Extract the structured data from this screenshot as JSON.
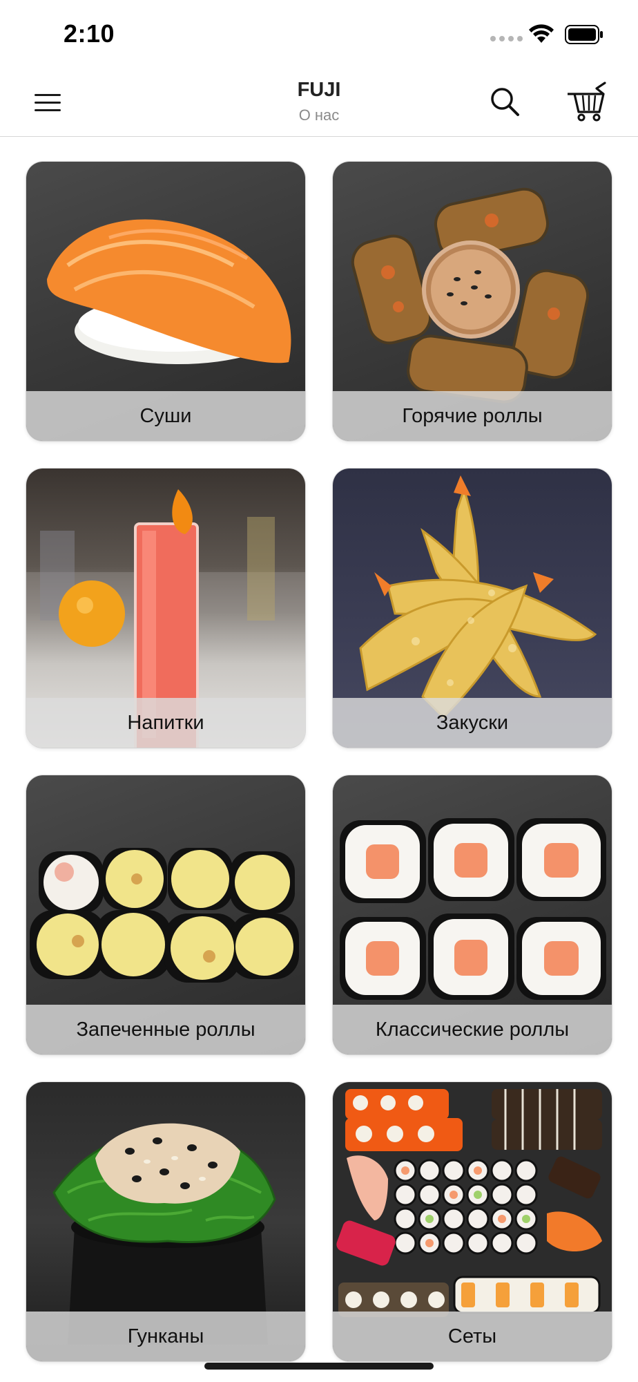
{
  "status_bar": {
    "time": "2:10"
  },
  "header": {
    "title": "FUJI",
    "subtitle": "О нас",
    "menu_icon": "hamburger-menu-icon",
    "search_icon": "search-icon",
    "cart_icon": "cart-icon"
  },
  "categories": [
    {
      "label": "Суши",
      "image": "salmon-nigiri"
    },
    {
      "label": "Горячие роллы",
      "image": "tempura-rolls-with-sauce"
    },
    {
      "label": "Напитки",
      "image": "red-cocktail-with-orange"
    },
    {
      "label": "Закуски",
      "image": "tempura-shrimp"
    },
    {
      "label": "Запеченные роллы",
      "image": "baked-rolls"
    },
    {
      "label": "Классические роллы",
      "image": "salmon-maki"
    },
    {
      "label": "Гунканы",
      "image": "gunkan-seaweed-salad"
    },
    {
      "label": "Сеты",
      "image": "sushi-set-platter"
    }
  ],
  "colors": {
    "label_bar": "#dcdcdc",
    "salmon": "#f07a2a",
    "seaweed": "#2e8a2a"
  }
}
